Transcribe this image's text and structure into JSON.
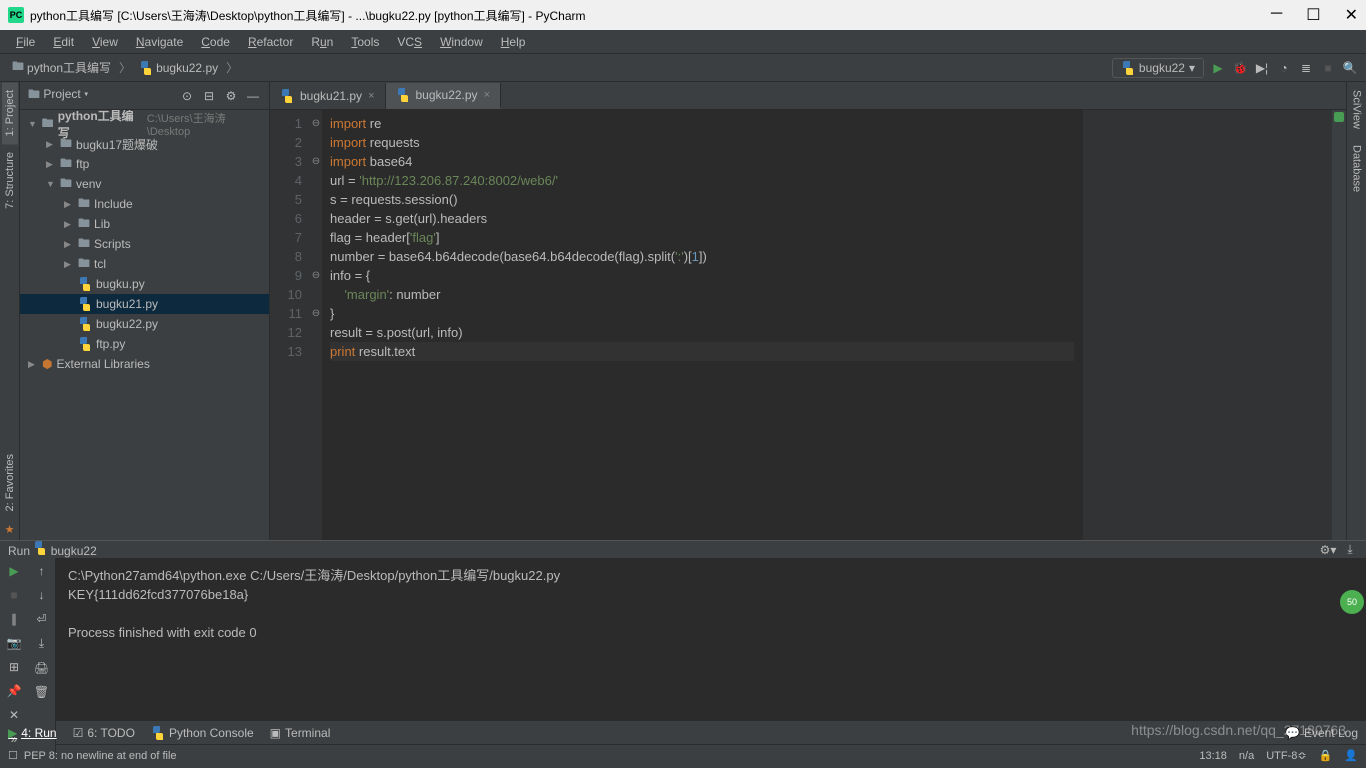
{
  "window": {
    "title": "python工具编写 [C:\\Users\\王海涛\\Desktop\\python工具编写] - ...\\bugku22.py [python工具编写] - PyCharm"
  },
  "menu": [
    "File",
    "Edit",
    "View",
    "Navigate",
    "Code",
    "Refactor",
    "Run",
    "Tools",
    "VCS",
    "Window",
    "Help"
  ],
  "breadcrumb": {
    "root": "python工具编写",
    "file": "bugku22.py"
  },
  "run_config": {
    "selected": "bugku22"
  },
  "project": {
    "title": "Project",
    "root": {
      "name": "python工具编写",
      "path": "C:\\Users\\王海涛\\Desktop"
    },
    "items": [
      {
        "name": "bugku17题爆破",
        "type": "folder",
        "depth": 1,
        "expanded": false,
        "arrow": "▶"
      },
      {
        "name": "ftp",
        "type": "folder",
        "depth": 1,
        "expanded": false,
        "arrow": "▶"
      },
      {
        "name": "venv",
        "type": "folder",
        "depth": 1,
        "expanded": true,
        "arrow": "▼"
      },
      {
        "name": "Include",
        "type": "folder",
        "depth": 2,
        "expanded": false,
        "arrow": "▶"
      },
      {
        "name": "Lib",
        "type": "folder",
        "depth": 2,
        "expanded": false,
        "arrow": "▶"
      },
      {
        "name": "Scripts",
        "type": "folder",
        "depth": 2,
        "expanded": false,
        "arrow": "▶"
      },
      {
        "name": "tcl",
        "type": "folder",
        "depth": 2,
        "expanded": false,
        "arrow": "▶"
      },
      {
        "name": "bugku.py",
        "type": "py",
        "depth": 2,
        "arrow": ""
      },
      {
        "name": "bugku21.py",
        "type": "py",
        "depth": 2,
        "arrow": "",
        "selected": true
      },
      {
        "name": "bugku22.py",
        "type": "py",
        "depth": 2,
        "arrow": ""
      },
      {
        "name": "ftp.py",
        "type": "py",
        "depth": 2,
        "arrow": ""
      }
    ],
    "external": "External Libraries"
  },
  "tabs": [
    {
      "label": "bugku21.py",
      "active": false
    },
    {
      "label": "bugku22.py",
      "active": true
    }
  ],
  "code": {
    "lines": [
      [
        [
          "kw",
          "import"
        ],
        [
          "",
          " re"
        ]
      ],
      [
        [
          "kw",
          "import"
        ],
        [
          "",
          " requests"
        ]
      ],
      [
        [
          "kw",
          "import"
        ],
        [
          "",
          " base64"
        ]
      ],
      [
        [
          "",
          "url = "
        ],
        [
          "str",
          "'http://123.206.87.240:8002/web6/'"
        ]
      ],
      [
        [
          "",
          "s = requests.session()"
        ]
      ],
      [
        [
          "",
          "header = s.get(url).headers"
        ]
      ],
      [
        [
          "",
          "flag = header["
        ],
        [
          "str",
          "'flag'"
        ],
        [
          "",
          "]"
        ]
      ],
      [
        [
          "",
          "number = base64.b64decode(base64.b64decode(flag).split("
        ],
        [
          "str",
          "':'"
        ],
        [
          "",
          ")["
        ],
        [
          "num",
          "1"
        ],
        [
          "",
          "])"
        ]
      ],
      [
        [
          "",
          "info = {"
        ]
      ],
      [
        [
          "",
          "    "
        ],
        [
          "str",
          "'margin'"
        ],
        [
          "",
          ": number"
        ]
      ],
      [
        [
          "",
          "}"
        ]
      ],
      [
        [
          "",
          "result = s.post(url, info)"
        ]
      ],
      [
        [
          "kw",
          "print"
        ],
        [
          "",
          " result.text"
        ]
      ]
    ],
    "current_line": 13
  },
  "run_panel": {
    "title": "Run",
    "config": "bugku22",
    "output": [
      "C:\\Python27amd64\\python.exe C:/Users/王海涛/Desktop/python工具编写/bugku22.py",
      "KEY{111dd62fcd377076be18a}",
      "",
      "Process finished with exit code 0"
    ]
  },
  "left_tabs": [
    "1: Project",
    "7: Structure"
  ],
  "left_tabs2": [
    "2: Favorites"
  ],
  "right_tabs": [
    "SciView",
    "Database"
  ],
  "bottom_tabs": {
    "items": [
      "4: Run",
      "6: TODO",
      "Python Console",
      "Terminal"
    ],
    "active": 0,
    "event_log": "Event Log"
  },
  "status": {
    "msg": "PEP 8: no newline at end of file",
    "pos": "13:18",
    "sep": "n/a",
    "enc": "UTF-8"
  },
  "watermark": "https://blog.csdn.net/qq_27180763"
}
